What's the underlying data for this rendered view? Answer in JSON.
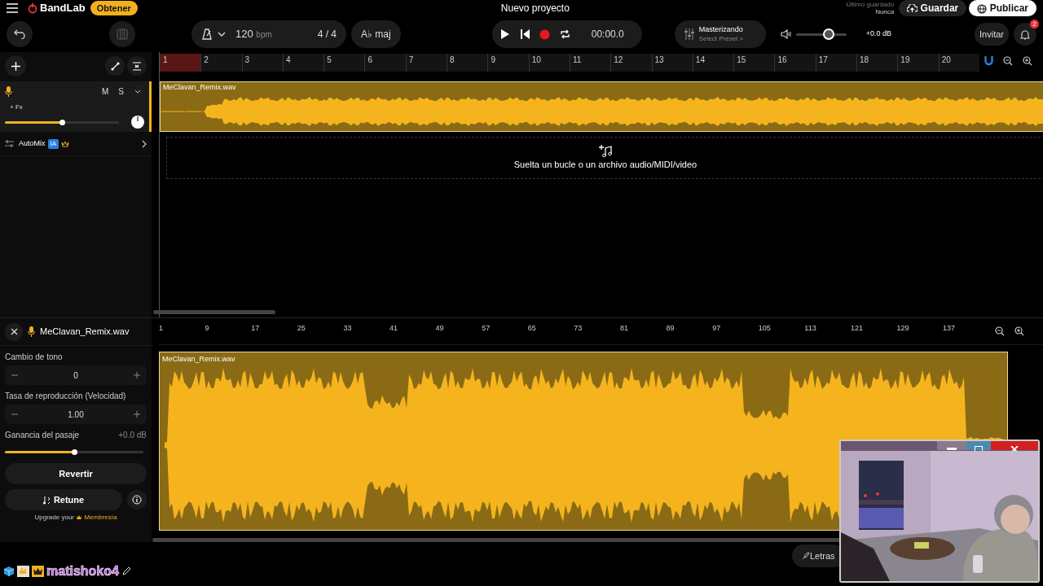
{
  "top_bar": {
    "brand": "BandLab",
    "get_button": "Obtener",
    "project_title": "Nuevo proyecto",
    "last_saved_label": "Último guardado",
    "last_saved_value": "Nunca",
    "save_button": "Guardar",
    "publish_button": "Publicar"
  },
  "toolbar": {
    "tempo": "120",
    "tempo_unit": "bpm",
    "time_signature": "4 / 4",
    "key": "A♭ maj",
    "time": "00:00.0",
    "mastering_title": "Masterizando",
    "mastering_preset": "Select Preset >",
    "volume": {
      "level": 0.65
    },
    "volume_reading": "+0.0 dB",
    "invite_button": "Invitar",
    "notification_count": "2"
  },
  "track": {
    "mute_button": "M",
    "solo_button": "S",
    "fx_button": "+ Fx",
    "volume": {
      "level": 0.5
    },
    "clip_name": "MeClavan_Remix.wav"
  },
  "automix": {
    "label": "AutoMix",
    "badge": "IA"
  },
  "ruler": [
    {
      "label": "1",
      "selected": true
    },
    {
      "label": "2",
      "selected": false
    },
    {
      "label": "3",
      "selected": false
    },
    {
      "label": "4",
      "selected": false
    },
    {
      "label": "5",
      "selected": false
    },
    {
      "label": "6",
      "selected": false
    },
    {
      "label": "7",
      "selected": false
    },
    {
      "label": "8",
      "selected": false
    },
    {
      "label": "9",
      "selected": false
    },
    {
      "label": "10",
      "selected": false
    },
    {
      "label": "11",
      "selected": false
    },
    {
      "label": "12",
      "selected": false
    },
    {
      "label": "13",
      "selected": false
    },
    {
      "label": "14",
      "selected": false
    },
    {
      "label": "15",
      "selected": false
    },
    {
      "label": "16",
      "selected": false
    },
    {
      "label": "17",
      "selected": false
    },
    {
      "label": "18",
      "selected": false
    },
    {
      "label": "19",
      "selected": false
    },
    {
      "label": "20",
      "selected": false
    }
  ],
  "drop_zone_text": "Suelta un bucle o un archivo audio/MIDI/video",
  "editor": {
    "file_name": "MeClavan_Remix.wav",
    "pitch_label": "Cambio de tono",
    "pitch_value": "0",
    "rate_label": "Tasa de reproducción (Velocidad)",
    "rate_value": "1.00",
    "gain_label": "Ganancia del pasaje",
    "gain_reading": "+0.0 dB",
    "gain": {
      "level": 0.5
    },
    "revert_button": "Revertir",
    "retune_button": "Retune",
    "upgrade_text": "Upgrade your",
    "membership_link": "Membresía",
    "ruler": [
      "1",
      "9",
      "17",
      "25",
      "33",
      "41",
      "49",
      "57",
      "65",
      "73",
      "81",
      "89",
      "97",
      "105",
      "113",
      "121",
      "129",
      "137"
    ],
    "clip_name": "MeClavan_Remix.wav"
  },
  "bottom_bar": {
    "lyrics_button": "Letras"
  },
  "stream_overlay": {
    "username": "matishoko4"
  }
}
